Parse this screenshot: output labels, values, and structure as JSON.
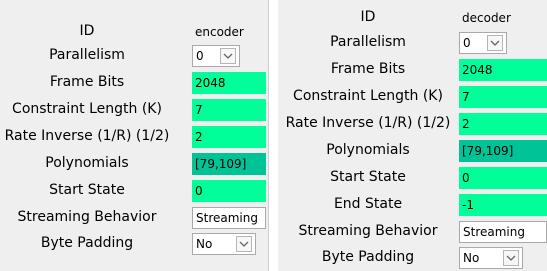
{
  "encoder": {
    "id_label": "ID",
    "id_value": "encoder",
    "parallelism_label": "Parallelism",
    "parallelism_value": "0",
    "frame_bits_label": "Frame Bits",
    "frame_bits_value": "2048",
    "constraint_length_label": "Constraint Length (K)",
    "constraint_length_value": "7",
    "rate_inverse_label": "Rate Inverse (1/R) (1/2)",
    "rate_inverse_value": "2",
    "polynomials_label": "Polynomials",
    "polynomials_value": "[79,109]",
    "start_state_label": "Start State",
    "start_state_value": "0",
    "streaming_behavior_label": "Streaming Behavior",
    "streaming_behavior_value": "Streaming",
    "byte_padding_label": "Byte Padding",
    "byte_padding_value": "No"
  },
  "decoder": {
    "id_label": "ID",
    "id_value": "decoder",
    "parallelism_label": "Parallelism",
    "parallelism_value": "0",
    "frame_bits_label": "Frame Bits",
    "frame_bits_value": "2048",
    "constraint_length_label": "Constraint Length (K)",
    "constraint_length_value": "7",
    "rate_inverse_label": "Rate Inverse (1/R) (1/2)",
    "rate_inverse_value": "2",
    "polynomials_label": "Polynomials",
    "polynomials_value": "[79,109]",
    "start_state_label": "Start State",
    "start_state_value": "0",
    "end_state_label": "End State",
    "end_state_value": "-1",
    "streaming_behavior_label": "Streaming Behavior",
    "streaming_behavior_value": "Streaming",
    "byte_padding_label": "Byte Padding",
    "byte_padding_value": "No"
  },
  "colors": {
    "field_green": "#00ff99",
    "field_selected": "#00c497",
    "panel_bg": "#efefef"
  },
  "icons": {
    "dropdown": "chevron-down-icon"
  }
}
